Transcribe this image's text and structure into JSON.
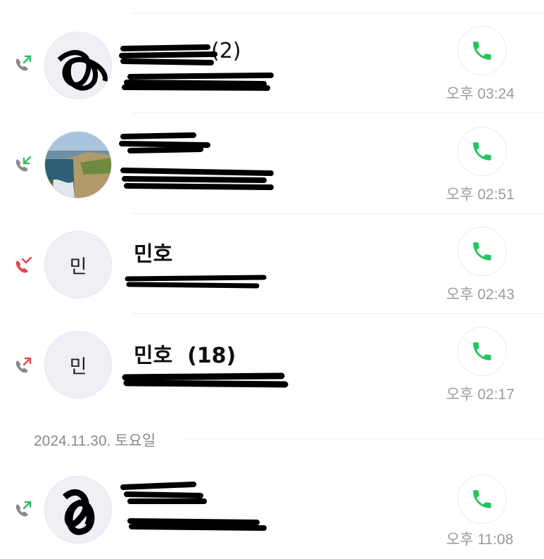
{
  "colors": {
    "outgoing_arrow": "#2dbe60",
    "incoming_arrow": "#2dbe60",
    "missed": "#e8474a",
    "phone_green": "#22c55e",
    "time_text": "#9a9a9a",
    "avatar_bg": "#eef0f6"
  },
  "calls": [
    {
      "direction_icon": "outgoing-call-icon",
      "avatar_text": "",
      "name": "",
      "visible_count": "(2)",
      "time": "오후 03:24",
      "redacted": true
    },
    {
      "direction_icon": "incoming-call-icon",
      "avatar_text": "",
      "avatar_photo": "coastal-cliff-photo",
      "name": "",
      "time": "오후 02:51",
      "redacted": true
    },
    {
      "direction_icon": "missed-call-icon",
      "avatar_text": "민",
      "name": "민호",
      "time": "오후 02:43",
      "redacted": true
    },
    {
      "direction_icon": "outgoing-call-icon",
      "avatar_text": "민",
      "name": "민호  (18)",
      "time": "오후 02:17",
      "redacted": true
    }
  ],
  "date_section": {
    "label": "2024.11.30. 토요일",
    "calls": [
      {
        "direction_icon": "outgoing-call-icon",
        "avatar_text": "",
        "name": "",
        "time": "오후 11:08",
        "redacted": true
      }
    ]
  }
}
